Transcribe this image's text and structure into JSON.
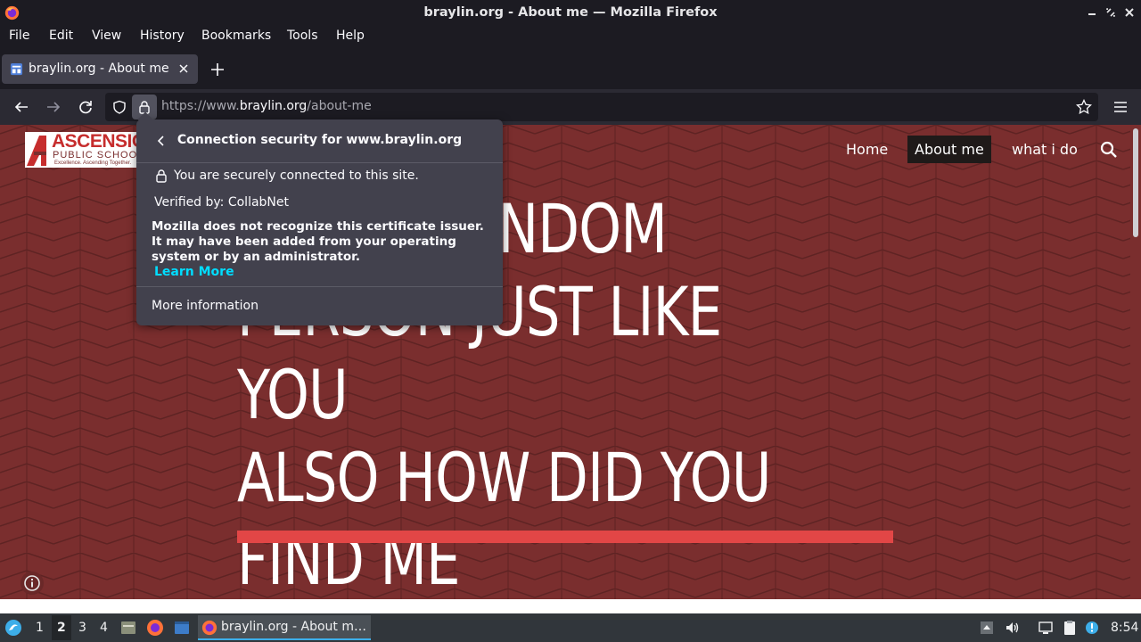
{
  "window": {
    "title": "braylin.org - About me — Mozilla Firefox"
  },
  "menubar": {
    "items": [
      "File",
      "Edit",
      "View",
      "History",
      "Bookmarks",
      "Tools",
      "Help"
    ]
  },
  "tab": {
    "label": "braylin.org - About me"
  },
  "urlbar": {
    "scheme": "https://www.",
    "host": "braylin.org",
    "path": "/about-me"
  },
  "site": {
    "logo": {
      "line1": "ASCENSION",
      "line2": "PUBLIC SCHOOLS",
      "tagline": "Excellence. Ascending Together."
    },
    "nav": [
      "Home",
      "About me",
      "what i do"
    ],
    "active_nav": "About me",
    "hero_lines": [
      "JUST A RANDOM",
      "PERSON JUST LIKE YOU",
      "ALSO HOW DID YOU",
      "FIND ME"
    ],
    "hero_rule_color": "#e24646",
    "background_color": "#7a2e2e"
  },
  "popup": {
    "title": "Connection security for www.braylin.org",
    "secure_text": "You are securely connected to this site.",
    "verified_text": "Verified by: CollabNet",
    "warning_text": "Mozilla does not recognize this certificate issuer. It may have been added from your operating system or by an administrator.",
    "learn_more": "Learn More",
    "more_info": "More information",
    "link_color": "#00ddff"
  },
  "taskbar": {
    "workspaces": [
      "1",
      "2",
      "3",
      "4"
    ],
    "active_workspace": "2",
    "task_label": "braylin.org - About m…",
    "clock": "8:54",
    "accent_color": "#3daee9"
  }
}
